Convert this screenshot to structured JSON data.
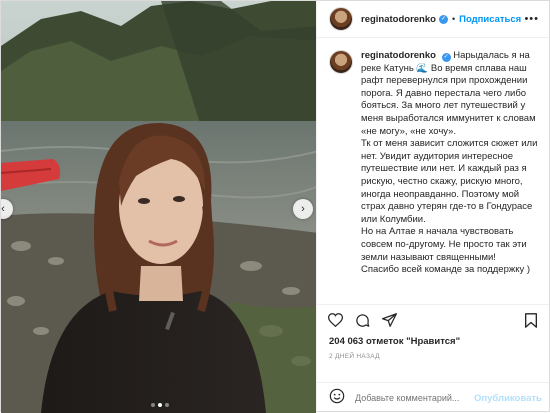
{
  "post": {
    "username": "reginatodorenko",
    "follow_label": "Подписаться",
    "separator": "•",
    "more_glyph": "•••"
  },
  "caption": {
    "username": "reginatodorenko",
    "paragraphs": [
      "Нарыдалась я на реке Катунь 🌊 Во время сплава наш рафт перевернулся при прохождении порога. Я давно перестала чего либо бояться. За много лет путешествий у меня выработался иммунитет к словам «не могу», «не хочу».",
      "Тк от меня зависит сложится сюжет или нет. Увидит аудитория интересное путешествие или нет. И каждый раз я рискую, честно скажу, рискую много, иногда неоправданно. Поэтому мой страх давно утерян где-то в Гондурасе или Колумбии.",
      "Но на Алтае я начала чувствовать совсем по-другому. Не просто так эти земли называют священными!",
      "Спасибо всей команде за поддержку )"
    ]
  },
  "stats": {
    "likes": "204 063 отметок \"Нравится\"",
    "date": "2 ДНЕЙ НАЗАД"
  },
  "comment": {
    "placeholder": "Добавьте комментарий...",
    "publish_label": "Опубликовать"
  },
  "carousel": {
    "dot_count": 3,
    "active_index": 1
  },
  "icons": {
    "heart": "heart-icon",
    "comment": "comment-icon",
    "share": "share-icon",
    "save": "bookmark-icon",
    "emoji": "emoji-icon",
    "verified": "verified-badge-icon"
  },
  "colors": {
    "link_blue": "#0095f6",
    "verified_blue": "#3897f0",
    "muted": "#8e8e8e",
    "publish_disabled": "#b2dffc"
  }
}
